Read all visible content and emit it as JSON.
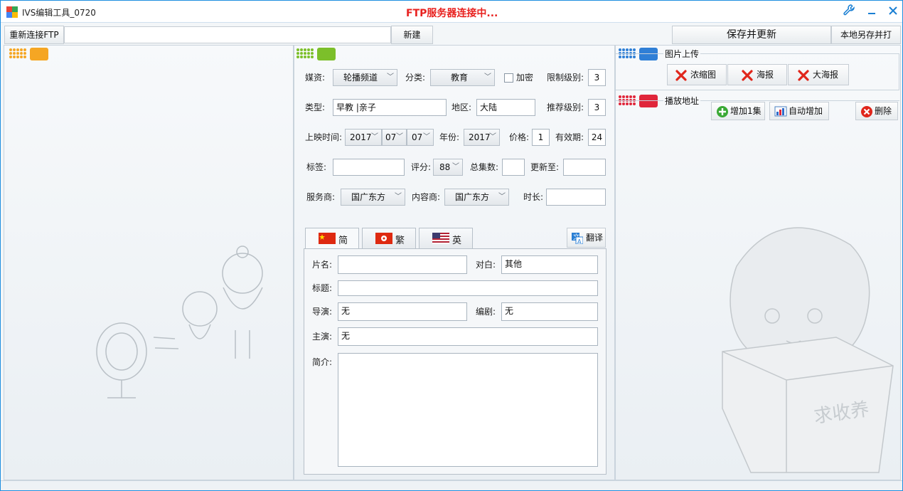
{
  "title_bar": {
    "app_title": "IVS编辑工具_0720",
    "status": "FTP服务器连接中...",
    "accent_color": "#1f8fe0",
    "status_color": "#e8211f"
  },
  "toolbar": {
    "reconnect_label": "重新连接FTP",
    "ftp_address": "",
    "new_label": "新建",
    "save_update_label": "保存并更新",
    "save_local_label": "本地另存并打"
  },
  "form": {
    "media_label": "媒资:",
    "media_value": "轮播频道",
    "category_label": "分类:",
    "category_value": "教育",
    "encrypt_label": "加密",
    "restrict_level_label": "限制级别:",
    "restrict_level_value": "3",
    "type_label": "类型:",
    "type_value": "早教 |亲子",
    "region_label": "地区:",
    "region_value": "大陆",
    "recommend_level_label": "推荐级别:",
    "recommend_level_value": "3",
    "release_label": "上映时间:",
    "release_year": "2017",
    "release_month": "07",
    "release_day": "07",
    "year_label": "年份:",
    "year_value": "2017",
    "price_label": "价格:",
    "price_value": "1",
    "validity_label": "有效期:",
    "validity_value": "24",
    "tags_label": "标签:",
    "tags_value": "",
    "rating_label": "评分:",
    "rating_value": "88",
    "total_episodes_label": "总集数:",
    "total_episodes_value": "",
    "updated_to_label": "更新至:",
    "updated_to_value": "",
    "provider_label": "服务商:",
    "provider_value": "国广东方",
    "content_provider_label": "内容商:",
    "content_provider_value": "国广东方",
    "duration_label": "时长:",
    "duration_value": ""
  },
  "lang_tabs": [
    {
      "label": "简",
      "flag": "china-flag-icon"
    },
    {
      "label": "繁",
      "flag": "hongkong-flag-icon"
    },
    {
      "label": "英",
      "flag": "usa-flag-icon"
    }
  ],
  "translate_label": "翻译",
  "details": {
    "name_label": "片名:",
    "name_value": "",
    "dialogue_label": "对白:",
    "dialogue_value": "其他",
    "title_label": "标题:",
    "title_value": "",
    "director_label": "导演:",
    "director_value": "无",
    "writer_label": "编剧:",
    "writer_value": "无",
    "cast_label": "主演:",
    "cast_value": "无",
    "intro_label": "简介:",
    "intro_value": ""
  },
  "image_upload": {
    "title": "图片上传",
    "thumbnail_label": "浓缩图",
    "poster_label": "海报",
    "big_poster_label": "大海报"
  },
  "play_address": {
    "title": "播放地址",
    "add_one_label": "增加1集",
    "auto_add_label": "自动增加",
    "delete_label": "删除"
  },
  "decoration": {
    "box_text": "求收养"
  }
}
